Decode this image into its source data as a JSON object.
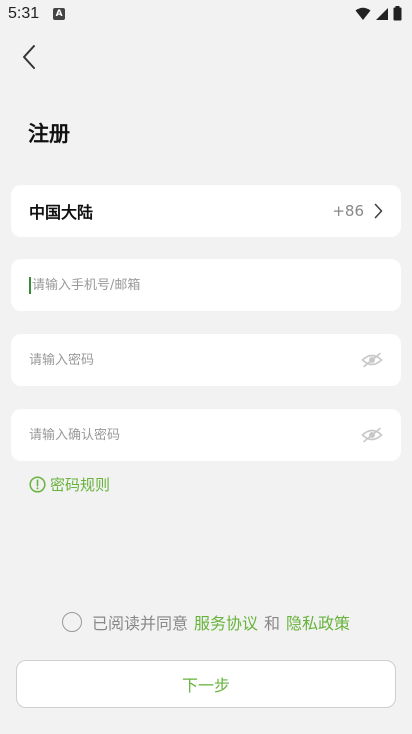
{
  "status_bar": {
    "time": "5:31",
    "app_icon_letter": "A"
  },
  "header": {
    "title": "注册"
  },
  "region": {
    "name": "中国大陆",
    "code": "+86"
  },
  "fields": {
    "phone_placeholder": "请输入手机号/邮箱",
    "password_placeholder": "请输入密码",
    "confirm_placeholder": "请输入确认密码"
  },
  "password_rules": {
    "label": "密码规则"
  },
  "agreement": {
    "prefix": "已阅读并同意",
    "terms_link": "服务协议",
    "conjunction": "和",
    "privacy_link": "隐私政策"
  },
  "actions": {
    "next_label": "下一步"
  },
  "colors": {
    "accent": "#67b33c",
    "background": "#f2f2f2",
    "card": "#ffffff"
  }
}
